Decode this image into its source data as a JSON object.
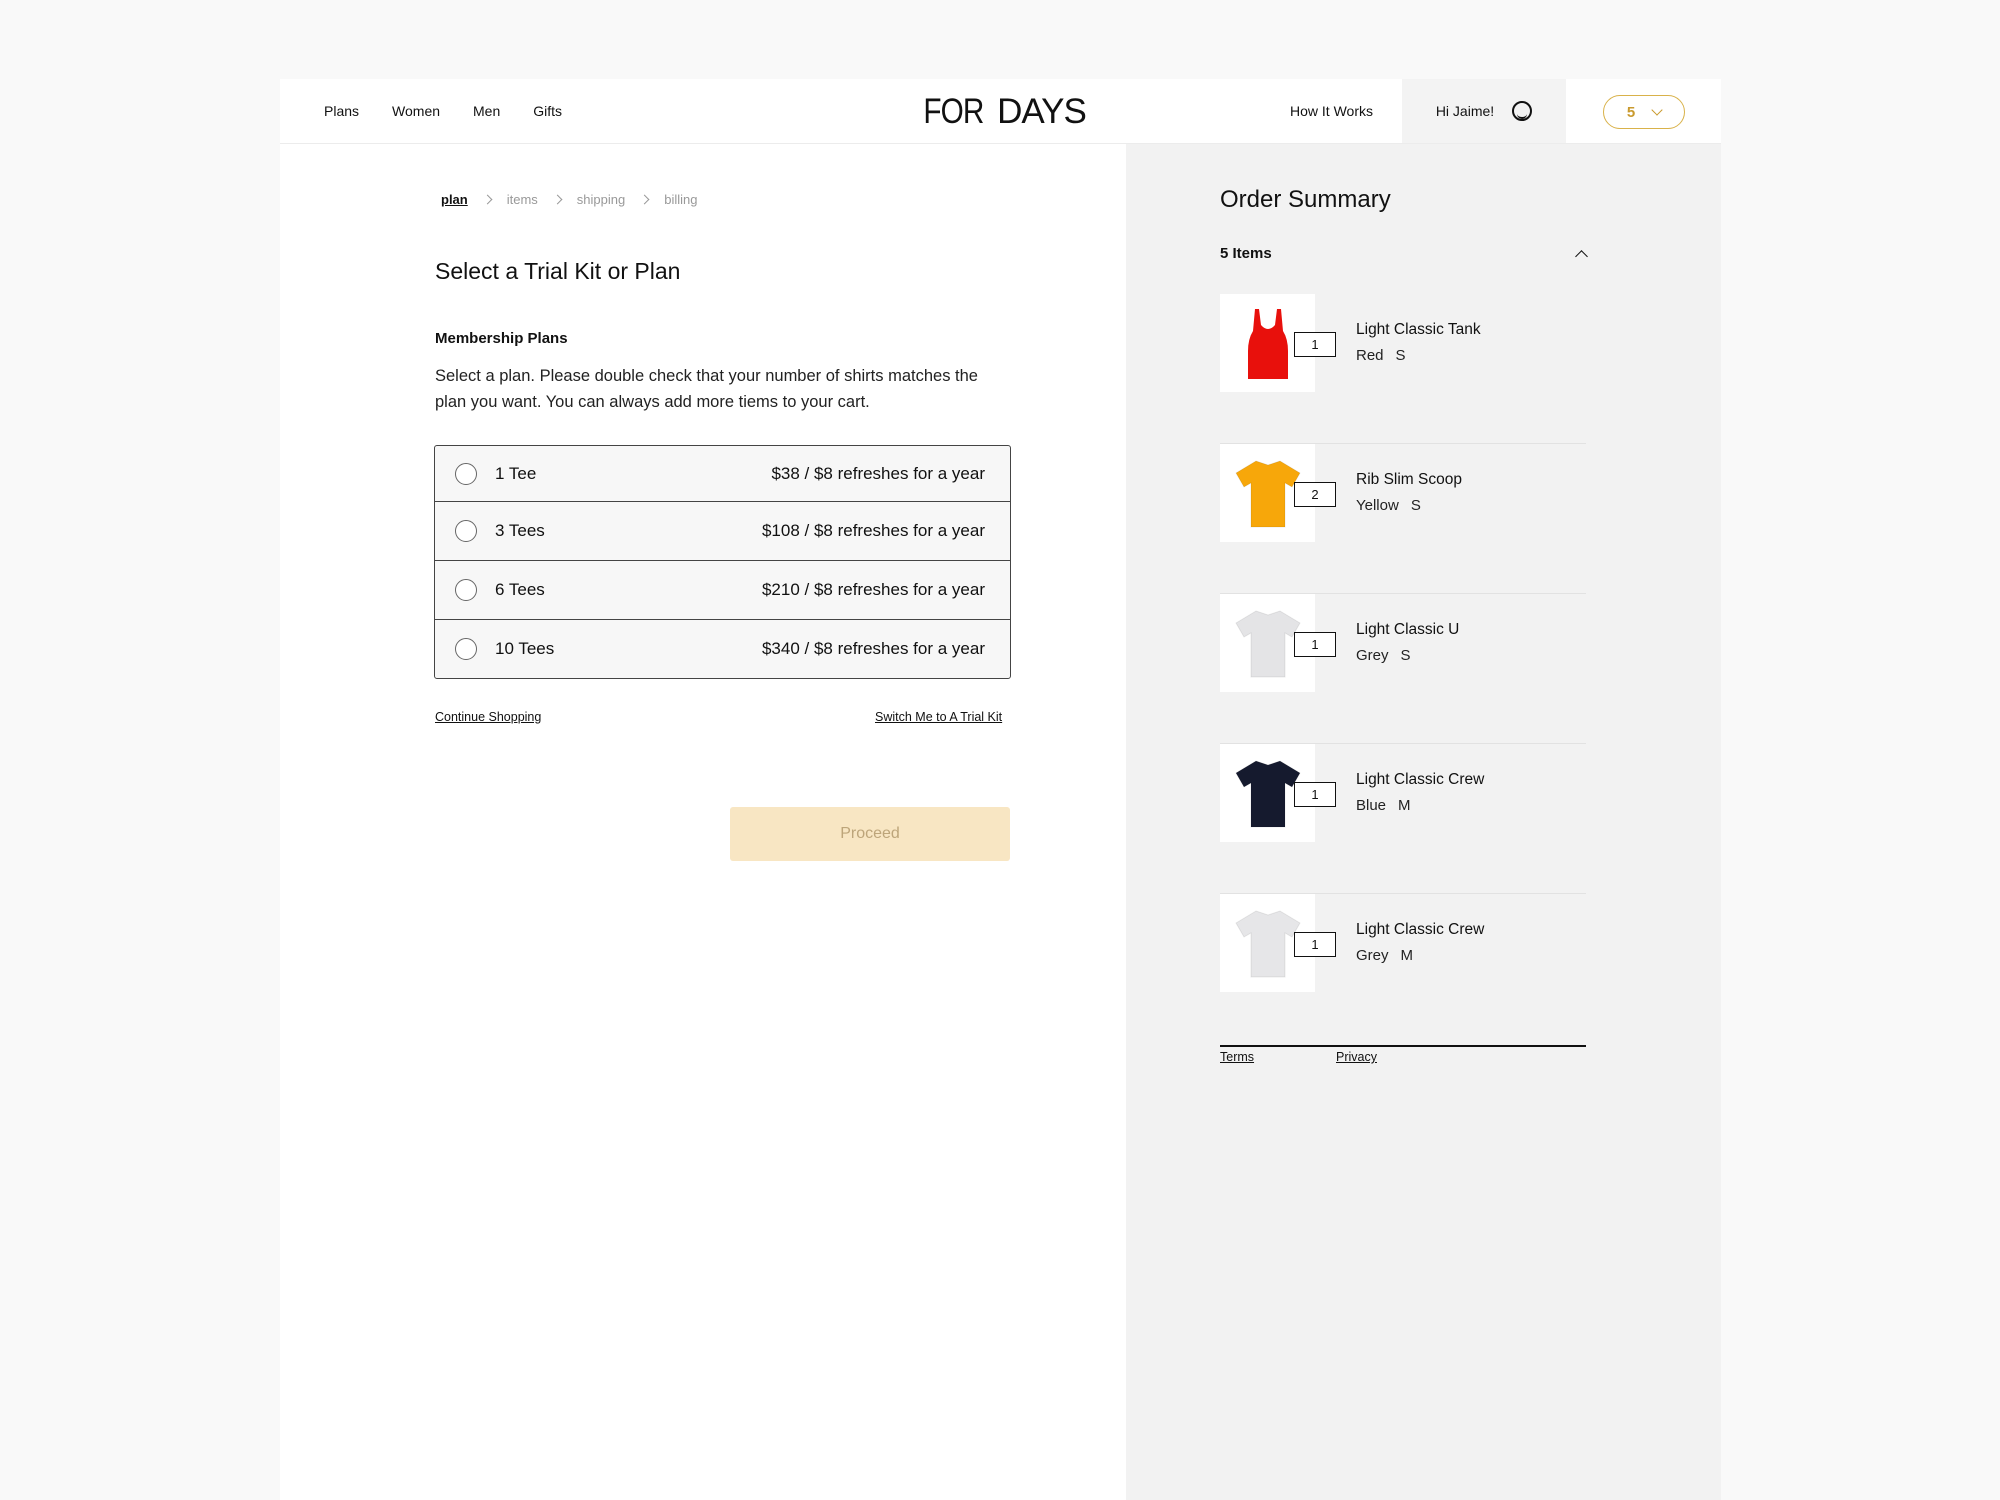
{
  "header": {
    "nav": [
      "Plans",
      "Women",
      "Men",
      "Gifts"
    ],
    "logo_left": "FOR",
    "logo_right": "DAYS",
    "how_it_works": "How It Works",
    "greeting": "Hi Jaime!",
    "cart_count": "5"
  },
  "checkout": {
    "steps": [
      "plan",
      "items",
      "shipping",
      "billing"
    ],
    "active_step": "plan",
    "title": "Select a Trial Kit or Plan",
    "section_title": "Membership Plans",
    "description": "Select a plan. Please double check that your number of shirts matches the plan you want. You can always add more tiems to your cart.",
    "plans": [
      {
        "name": "1 Tee",
        "price": "$38 / $8 refreshes for a year"
      },
      {
        "name": "3 Tees",
        "price": "$108 / $8 refreshes for a year"
      },
      {
        "name": "6 Tees",
        "price": "$210 / $8 refreshes for a year"
      },
      {
        "name": "10 Tees",
        "price": "$340 / $8 refreshes for a year"
      }
    ],
    "continue_link": "Continue Shopping",
    "switch_link": "Switch Me to A Trial Kit",
    "proceed_label": "Proceed"
  },
  "order_summary": {
    "title": "Order Summary",
    "count_label": "5 Items",
    "items": [
      {
        "name": "Light Classic Tank",
        "color": "Red",
        "size": "S",
        "qty": "1",
        "swatch": "#e8100c",
        "icon": "tank-top-icon"
      },
      {
        "name": "Rib Slim Scoop",
        "color": "Yellow",
        "size": "S",
        "qty": "2",
        "swatch": "#f7a70a",
        "icon": "tshirt-icon"
      },
      {
        "name": "Light Classic U",
        "color": "Grey",
        "size": "S",
        "qty": "1",
        "swatch": "#e4e4e6",
        "icon": "tshirt-icon"
      },
      {
        "name": "Light Classic Crew",
        "color": "Blue",
        "size": "M",
        "qty": "1",
        "swatch": "#151a2e",
        "icon": "tshirt-icon"
      },
      {
        "name": "Light Classic Crew",
        "color": "Grey",
        "size": "M",
        "qty": "1",
        "swatch": "#e6e6e8",
        "icon": "tshirt-icon"
      }
    ],
    "terms": "Terms",
    "privacy": "Privacy"
  },
  "colors": {
    "accent": "#d9b24a",
    "proceed_bg": "#f8e6c3"
  }
}
